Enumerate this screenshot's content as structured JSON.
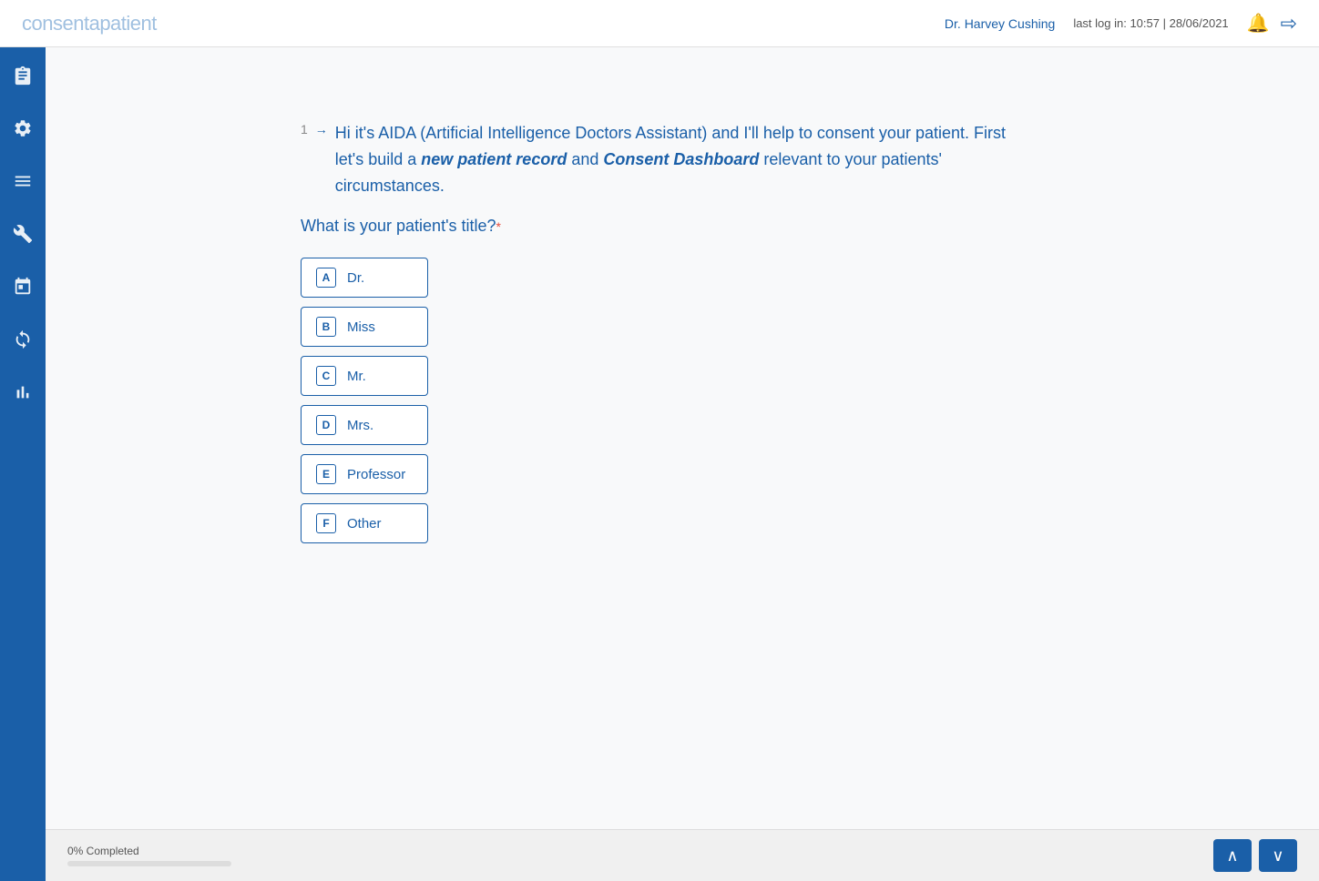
{
  "header": {
    "logo_text": "consent",
    "logo_a": "a",
    "logo_rest": "patient",
    "user": "Dr. Harvey Cushing",
    "last_login": "last log in: 10:57 | 28/06/2021",
    "bell_icon": "🔔",
    "logout_icon": "➜"
  },
  "sidebar": {
    "icons": [
      {
        "name": "clipboard-icon",
        "symbol": "📋"
      },
      {
        "name": "settings-icon",
        "symbol": "⚙"
      },
      {
        "name": "list-icon",
        "symbol": "☰"
      },
      {
        "name": "tools-icon",
        "symbol": "✂"
      },
      {
        "name": "calendar-icon",
        "symbol": "📅"
      },
      {
        "name": "refresh-icon",
        "symbol": "↻"
      },
      {
        "name": "chart-icon",
        "symbol": "📊"
      }
    ]
  },
  "question": {
    "number": "1",
    "arrow": "→",
    "text_part1": "Hi it's AIDA (Artificial Intelligence Doctors Assistant) and I'll help to consent your patient. First let's build a ",
    "text_italic1": "new patient record",
    "text_part2": " and ",
    "text_italic2": "Consent Dashboard",
    "text_part3": " relevant to your patients' circumstances.",
    "subtitle": "What is your patient's title?",
    "required": "*",
    "options": [
      {
        "key": "A",
        "label": "Dr."
      },
      {
        "key": "B",
        "label": "Miss"
      },
      {
        "key": "C",
        "label": "Mr."
      },
      {
        "key": "D",
        "label": "Mrs."
      },
      {
        "key": "E",
        "label": "Professor"
      },
      {
        "key": "F",
        "label": "Other"
      }
    ]
  },
  "footer": {
    "progress_label": "0% Completed",
    "progress_value": 0,
    "nav_up": "∧",
    "nav_down": "∨"
  }
}
